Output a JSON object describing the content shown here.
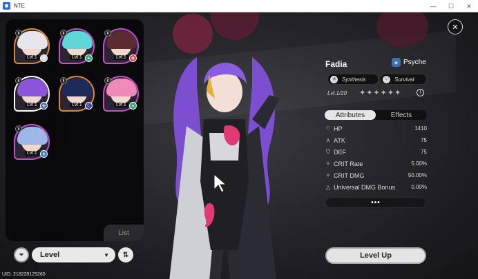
{
  "window": {
    "title": "NTE",
    "minimize": "—",
    "maximize": "☐",
    "close": "✕"
  },
  "roster": {
    "characters": [
      {
        "level": "Lvl.1",
        "element": "✥",
        "element_color": "#d8d8d8",
        "border": "#e08a30",
        "hair": "#e6e6ea"
      },
      {
        "level": "Lvl.1",
        "element": "♠",
        "element_color": "#2fa878",
        "border": "#c64fd0",
        "hair": "#5fd7d8"
      },
      {
        "level": "Lvl.1",
        "element": "◉",
        "element_color": "#d83a3a",
        "border": "#c64fd0",
        "hair": "#5b2b33"
      },
      {
        "level": "Lvl.1",
        "element": "◈",
        "element_color": "#3b6fb0",
        "border": "#ffffff",
        "hair": "#8a55d8",
        "selected": true
      },
      {
        "level": "Lvl.1",
        "element": "☾",
        "element_color": "#3a46b0",
        "border": "#e08a30",
        "hair": "#1e2a5a"
      },
      {
        "level": "Lvl.1",
        "element": "♠",
        "element_color": "#2fa878",
        "border": "#c64fd0",
        "hair": "#f08ab8"
      },
      {
        "level": "Lvl.1",
        "element": "◈",
        "element_color": "#3b6fb0",
        "border": "#c64fd0",
        "hair": "#9fb6e8"
      }
    ],
    "list_tab": "List"
  },
  "controls": {
    "filter_icon": "⏷",
    "sort_label": "Level",
    "sort_caret": "▼",
    "order_icon": "⇅"
  },
  "uid": "UID: 218228129260",
  "character": {
    "name": "Fadia",
    "element": "Psyche",
    "element_icon": "◈",
    "traits": [
      "Synthesis",
      "Survival"
    ],
    "level": "Lvl.1/20",
    "stars": "✦✦✦✦✦✦",
    "info_icon": "!"
  },
  "tabs": {
    "attributes": "Attributes",
    "effects": "Effects"
  },
  "stats": [
    {
      "icon": "♡",
      "label": "HP",
      "value": "1410"
    },
    {
      "icon": "⋏",
      "label": "ATK",
      "value": "75"
    },
    {
      "icon": "⛉",
      "label": "DEF",
      "value": "75"
    },
    {
      "icon": "✧",
      "label": "CRIT Rate",
      "value": "5.00%"
    },
    {
      "icon": "✧",
      "label": "CRIT DMG",
      "value": "50.00%"
    },
    {
      "icon": "△",
      "label": "Universal DMG Bonus",
      "value": "0.00%"
    }
  ],
  "more_label": "•••",
  "close_icon": "✕",
  "level_up_label": "Level Up"
}
